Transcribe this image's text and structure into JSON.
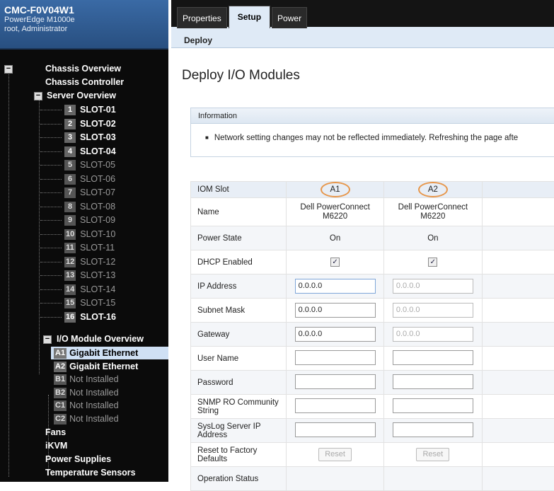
{
  "header": {
    "host": "CMC-F0V04W1",
    "model": "PowerEdge M1000e",
    "user": "root, Administrator"
  },
  "tree": {
    "chassis_overview": "Chassis Overview",
    "chassis_controller": "Chassis Controller",
    "server_overview": "Server Overview",
    "slots": [
      {
        "n": "1",
        "label": "SLOT-01",
        "present": true
      },
      {
        "n": "2",
        "label": "SLOT-02",
        "present": true
      },
      {
        "n": "3",
        "label": "SLOT-03",
        "present": true
      },
      {
        "n": "4",
        "label": "SLOT-04",
        "present": true
      },
      {
        "n": "5",
        "label": "SLOT-05",
        "present": false
      },
      {
        "n": "6",
        "label": "SLOT-06",
        "present": false
      },
      {
        "n": "7",
        "label": "SLOT-07",
        "present": false
      },
      {
        "n": "8",
        "label": "SLOT-08",
        "present": false
      },
      {
        "n": "9",
        "label": "SLOT-09",
        "present": false
      },
      {
        "n": "10",
        "label": "SLOT-10",
        "present": false
      },
      {
        "n": "11",
        "label": "SLOT-11",
        "present": false
      },
      {
        "n": "12",
        "label": "SLOT-12",
        "present": false
      },
      {
        "n": "13",
        "label": "SLOT-13",
        "present": false
      },
      {
        "n": "14",
        "label": "SLOT-14",
        "present": false
      },
      {
        "n": "15",
        "label": "SLOT-15",
        "present": false
      },
      {
        "n": "16",
        "label": "SLOT-16",
        "present": true
      }
    ],
    "io_overview": "I/O Module Overview",
    "io_modules": [
      {
        "n": "A1",
        "label": "Gigabit Ethernet",
        "present": true
      },
      {
        "n": "A2",
        "label": "Gigabit Ethernet",
        "present": true
      },
      {
        "n": "B1",
        "label": "Not Installed",
        "present": false
      },
      {
        "n": "B2",
        "label": "Not Installed",
        "present": false
      },
      {
        "n": "C1",
        "label": "Not Installed",
        "present": false
      },
      {
        "n": "C2",
        "label": "Not Installed",
        "present": false
      }
    ],
    "fans": "Fans",
    "ikvm": "iKVM",
    "power_supplies": "Power Supplies",
    "temperature_sensors": "Temperature Sensors",
    "toggle_minus": "−"
  },
  "tabs": {
    "properties": "Properties",
    "setup": "Setup",
    "power": "Power"
  },
  "subtab": "Deploy",
  "page_title": "Deploy I/O Modules",
  "info": {
    "header": "Information",
    "bullet": "■",
    "text": "Network setting changes may not be reflected immediately. Refreshing the page afte"
  },
  "table": {
    "labels": {
      "iom_slot": "IOM Slot",
      "name": "Name",
      "power_state": "Power State",
      "dhcp": "DHCP Enabled",
      "ip": "IP Address",
      "subnet": "Subnet Mask",
      "gateway": "Gateway",
      "user": "User Name",
      "password": "Password",
      "snmp": "SNMP RO Community String",
      "syslog": "SysLog Server IP Address",
      "reset": "Reset to Factory Defaults",
      "op_status": "Operation Status"
    },
    "a1": {
      "slot": "A1",
      "name1": "Dell PowerConnect",
      "name2": "M6220",
      "power": "On",
      "dhcp_mark": "✓",
      "ip": "0.0.0.0",
      "subnet": "0.0.0.0",
      "gateway": "0.0.0.0",
      "reset": "Reset"
    },
    "a2": {
      "slot": "A2",
      "name1": "Dell PowerConnect",
      "name2": "M6220",
      "power": "On",
      "dhcp_mark": "✓",
      "ip": "0.0.0.0",
      "subnet": "0.0.0.0",
      "gateway": "0.0.0.0",
      "reset": "Reset"
    }
  }
}
